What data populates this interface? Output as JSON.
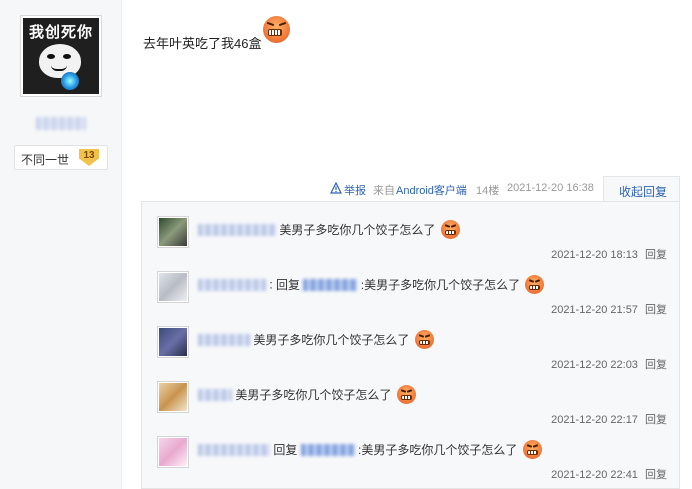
{
  "author": {
    "avatar_caption": "我创死你",
    "title": "不同一世",
    "level": "13"
  },
  "post": {
    "content": "去年叶英吃了我46盒",
    "emoji": "angry-grin-emoji"
  },
  "meta": {
    "report": "举报",
    "client_prefix": "来自",
    "client_name": "Android客户端",
    "floor": "14楼",
    "time": "2021-12-20 16:38",
    "collapse": "收起回复"
  },
  "replies": [
    {
      "prefix": "",
      "reply_word": "",
      "text": "美男子多吃你几个饺子怎么了",
      "time": "2021-12-20 18:13",
      "action": "回复"
    },
    {
      "prefix": ":",
      "reply_word": "回复",
      "text": ":美男子多吃你几个饺子怎么了",
      "time": "2021-12-20 21:57",
      "action": "回复"
    },
    {
      "prefix": "",
      "reply_word": "",
      "text": "美男子多吃你几个饺子怎么了",
      "time": "2021-12-20 22:03",
      "action": "回复"
    },
    {
      "prefix": "",
      "reply_word": "",
      "text": "美男子多吃你几个饺子怎么了",
      "time": "2021-12-20 22:17",
      "action": "回复"
    },
    {
      "prefix": "",
      "reply_word": "回复",
      "text": ":美男子多吃你几个饺子怎么了",
      "time": "2021-12-20 22:41",
      "action": "回复"
    }
  ],
  "colors": {
    "link": "#2d64b3",
    "panel_bg": "#f7f8fa",
    "sidebar_bg": "#f6f7f9"
  }
}
